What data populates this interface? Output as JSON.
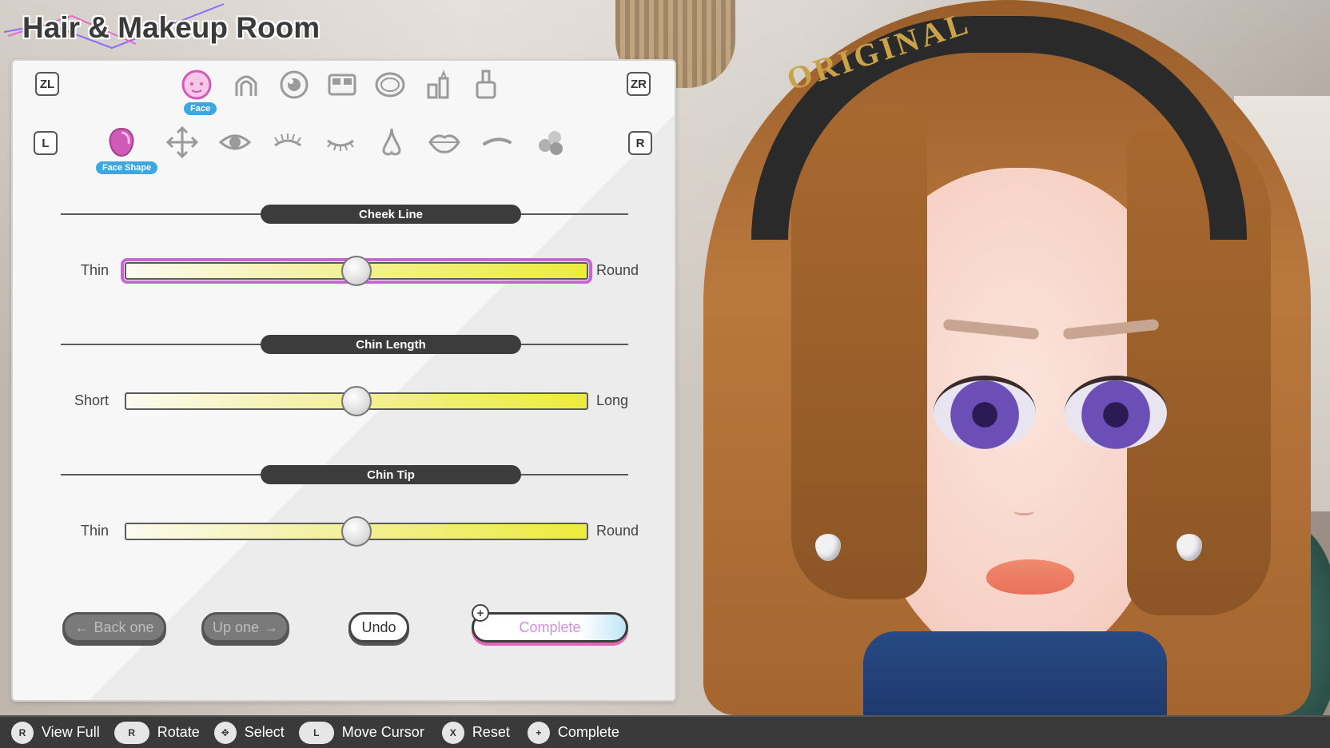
{
  "screen": {
    "title": "Hair & Makeup Room"
  },
  "header_keys": {
    "zl": "ZL",
    "zr": "ZR",
    "l": "L",
    "r": "R"
  },
  "category_tabs": {
    "selected_label": "Face",
    "items": [
      "face-icon",
      "hair-icon",
      "eye-color-icon",
      "eyeshadow-palette-icon",
      "compact-icon",
      "lipstick-icon",
      "nail-polish-icon"
    ]
  },
  "subcategory_tabs": {
    "selected_label": "Face Shape",
    "items": [
      "face-shape-icon",
      "move-icon",
      "eye-icon",
      "eyelashes-upper-icon",
      "eyelashes-icon",
      "nose-icon",
      "lips-icon",
      "eyebrow-icon",
      "mole-icon"
    ]
  },
  "sliders": [
    {
      "title": "Cheek Line",
      "left": "Thin",
      "right": "Round",
      "value": 0.5,
      "active": true
    },
    {
      "title": "Chin Length",
      "left": "Short",
      "right": "Long",
      "value": 0.5,
      "active": false
    },
    {
      "title": "Chin Tip",
      "left": "Thin",
      "right": "Round",
      "value": 0.5,
      "active": false
    }
  ],
  "buttons": {
    "back_one": "Back one",
    "up_one": "Up one",
    "undo": "Undo",
    "complete": "Complete",
    "plus": "+"
  },
  "character": {
    "headband_text": "ORIGINAL"
  },
  "footer": {
    "hints": [
      {
        "glyph": "R",
        "label": "View Full"
      },
      {
        "glyph": "R",
        "label": "Rotate"
      },
      {
        "glyph": "✥",
        "label": "Select"
      },
      {
        "glyph": "L",
        "label": "Move Cursor"
      },
      {
        "glyph": "X",
        "label": "Reset"
      },
      {
        "glyph": "+",
        "label": "Complete"
      }
    ]
  },
  "colors": {
    "accent_pink": "#c866d6",
    "selected_blue": "#3da7e0",
    "slider_yellow": "#ecec3c",
    "bar_dark": "#3a3a3a"
  }
}
